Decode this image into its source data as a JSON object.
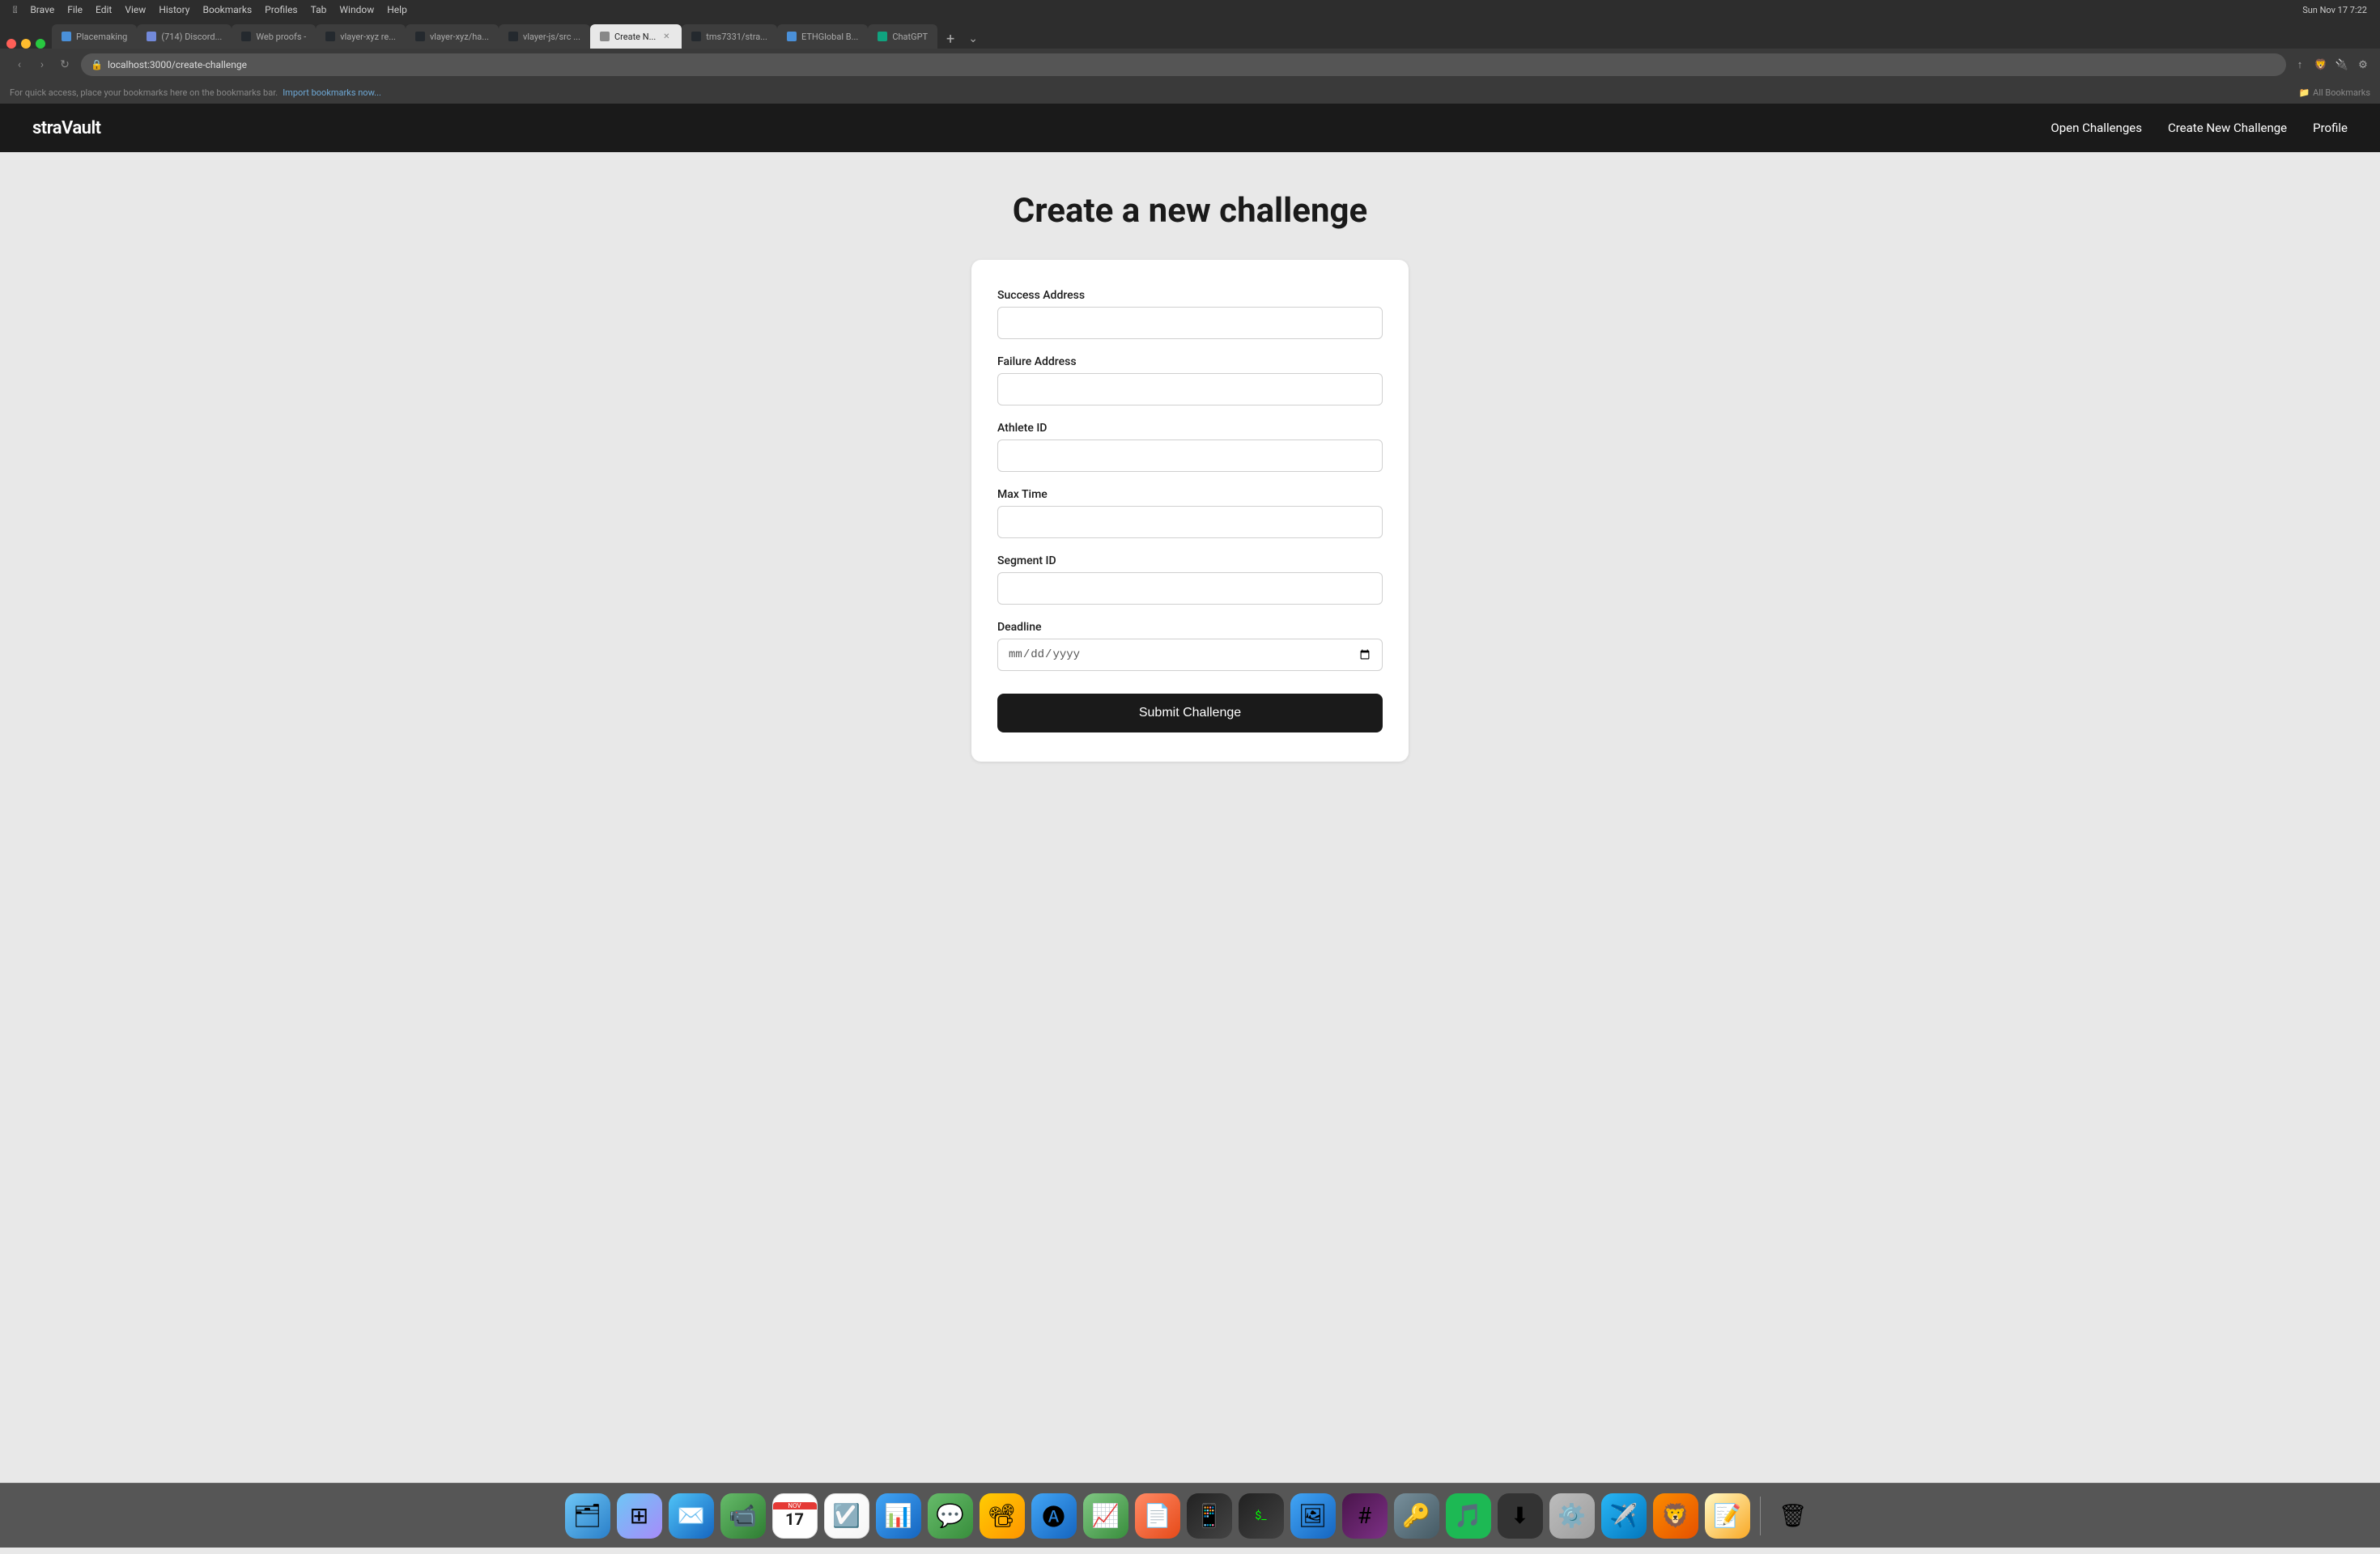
{
  "browser": {
    "title": "Brave",
    "url": "localhost:3000/create-challenge",
    "tabs": [
      {
        "id": "tab-1",
        "label": "Placemaking",
        "favicon_color": "#4a90d9",
        "active": false,
        "closable": false
      },
      {
        "id": "tab-2",
        "label": "(714) Discord...",
        "favicon_color": "#7289da",
        "active": false,
        "closable": false
      },
      {
        "id": "tab-3",
        "label": "Web proofs -",
        "favicon_color": "#24292e",
        "active": false,
        "closable": false
      },
      {
        "id": "tab-4",
        "label": "vlayer-xyz re...",
        "favicon_color": "#24292e",
        "active": false,
        "closable": false
      },
      {
        "id": "tab-5",
        "label": "vlayer-xyz/ha...",
        "favicon_color": "#24292e",
        "active": false,
        "closable": false
      },
      {
        "id": "tab-6",
        "label": "vlayer-js/src ...",
        "favicon_color": "#24292e",
        "active": false,
        "closable": false
      },
      {
        "id": "tab-7",
        "label": "Create N...",
        "favicon_color": "#e8e8e8",
        "active": true,
        "closable": true
      },
      {
        "id": "tab-8",
        "label": "tms7331/stra...",
        "favicon_color": "#24292e",
        "active": false,
        "closable": false
      },
      {
        "id": "tab-9",
        "label": "ETHGlobal B...",
        "favicon_color": "#4a90d9",
        "active": false,
        "closable": false
      },
      {
        "id": "tab-10",
        "label": "ChatGPT",
        "favicon_color": "#10a37f",
        "active": false,
        "closable": false
      }
    ],
    "bookmarks_bar_text": "For quick access, place your bookmarks here on the bookmarks bar.",
    "bookmarks_bar_link": "Import bookmarks now...",
    "bookmarks_all_label": "All Bookmarks"
  },
  "navbar": {
    "logo": "straVault",
    "links": [
      {
        "id": "open-challenges",
        "label": "Open Challenges"
      },
      {
        "id": "create-new-challenge",
        "label": "Create New Challenge"
      },
      {
        "id": "profile",
        "label": "Profile"
      }
    ]
  },
  "page": {
    "title": "Create a new challenge",
    "form": {
      "fields": [
        {
          "id": "success-address",
          "label": "Success Address",
          "type": "text",
          "placeholder": ""
        },
        {
          "id": "failure-address",
          "label": "Failure Address",
          "type": "text",
          "placeholder": ""
        },
        {
          "id": "athlete-id",
          "label": "Athlete ID",
          "type": "text",
          "placeholder": ""
        },
        {
          "id": "max-time",
          "label": "Max Time",
          "type": "text",
          "placeholder": ""
        },
        {
          "id": "segment-id",
          "label": "Segment ID",
          "type": "text",
          "placeholder": ""
        },
        {
          "id": "deadline",
          "label": "Deadline",
          "type": "date",
          "placeholder": "mm/dd/yyyy"
        }
      ],
      "submit_label": "Submit Challenge"
    }
  },
  "colors": {
    "navbar_bg": "#1a1a1a",
    "page_bg": "#e8e8e8",
    "form_bg": "#ffffff",
    "submit_bg": "#1a1a1a",
    "submit_text": "#ffffff"
  },
  "menu_bar_items": [
    "Brave",
    "File",
    "Edit",
    "View",
    "History",
    "Bookmarks",
    "Profiles",
    "Tab",
    "Window",
    "Help"
  ],
  "system_time": "Sun Nov 17  7:22"
}
